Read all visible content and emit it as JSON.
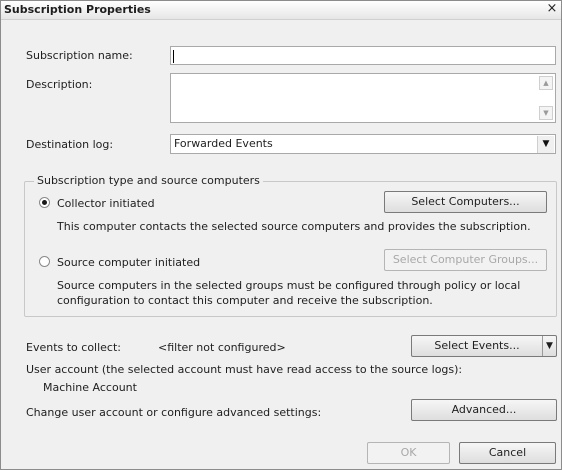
{
  "window": {
    "title": "Subscription Properties",
    "close_glyph": "×"
  },
  "form": {
    "subscription_name_label": "Subscription name:",
    "subscription_name_value": "",
    "description_label": "Description:",
    "description_value": "",
    "destination_log_label": "Destination log:",
    "destination_log_value": "Forwarded Events"
  },
  "group": {
    "legend": "Subscription type and source computers",
    "collector": {
      "label": "Collector initiated",
      "selected": true,
      "button": "Select Computers...",
      "description": "This computer contacts the selected source computers and provides the subscription."
    },
    "source": {
      "label": "Source computer initiated",
      "selected": false,
      "button": "Select Computer Groups...",
      "description_line1": "Source computers in the selected groups must be configured through policy or local",
      "description_line2": "configuration to contact this computer and receive the subscription."
    }
  },
  "events": {
    "label": "Events to collect:",
    "value": "<filter not configured>",
    "button": "Select Events..."
  },
  "account": {
    "label": "User account (the selected account must have read access to the source logs):",
    "value": "Machine Account",
    "advanced_label": "Change user account or configure advanced settings:",
    "advanced_button": "Advanced..."
  },
  "footer": {
    "ok_label": "OK",
    "cancel_label": "Cancel"
  },
  "icons": {
    "scroll_up": "▲",
    "scroll_down": "▼",
    "dropdown": "▼"
  }
}
